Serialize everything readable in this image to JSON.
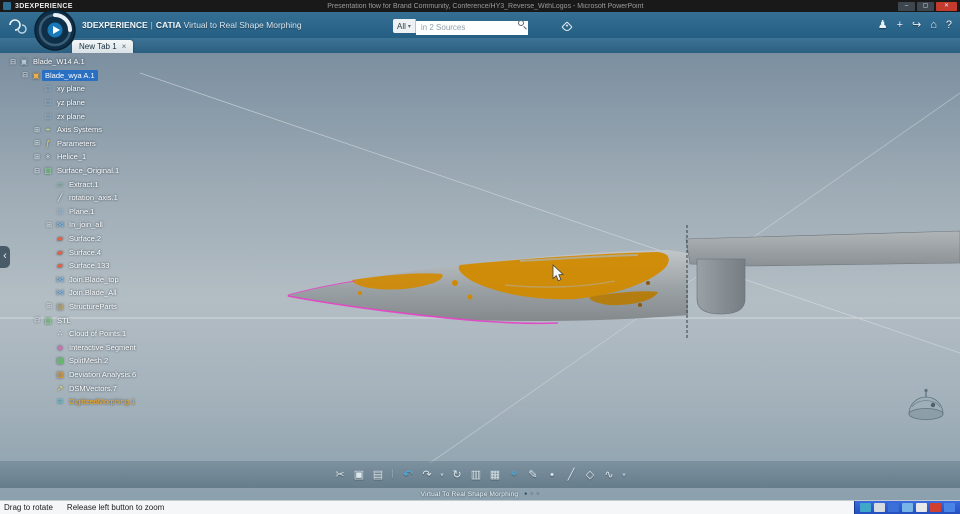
{
  "colors": {
    "selection_blue": "#2a70c2",
    "deviation_orange": "#d18a00",
    "deviation_orange_dark": "#b87a00",
    "scan_magenta": "#e83fc8",
    "blade_light": "#c2c6c8",
    "blade_mid": "#9aa1a4",
    "blade_dark": "#84898c",
    "hub_light": "#b0b5b8",
    "hub_dark": "#8a9094",
    "close_red": "#c23b2e",
    "line_gray": "#dbe1e5"
  },
  "window": {
    "brand": "3DEXPERIENCE",
    "title": "Presentation flow for Brand Community, Conference/HY3_Reverse_WithLogos - Microsoft PowerPoint",
    "minimize": "–",
    "maximize": "▢",
    "close": "✕"
  },
  "appbar": {
    "brand": "3DEXPERIENCE",
    "pipe": "|",
    "app": "CATIA",
    "title": "Virtual to Real Shape Morphing",
    "search": {
      "filter": "All",
      "caret": "▾",
      "placeholder": "in 2 Sources"
    },
    "right_icons": [
      {
        "name": "user-icon",
        "glyph": "♟"
      },
      {
        "name": "add-icon",
        "glyph": "+"
      },
      {
        "name": "share-icon",
        "glyph": "↪"
      },
      {
        "name": "home-icon",
        "glyph": "⌂"
      },
      {
        "name": "help-icon",
        "glyph": "?"
      }
    ]
  },
  "tabbar": {
    "tabs": [
      {
        "label": "New Tab 1",
        "close": "×"
      }
    ]
  },
  "tree": {
    "items": [
      {
        "label": "Blade_W14 A.1",
        "level": 0,
        "icon": "product-icon",
        "glyph": "▣",
        "color": "#b0c8d8",
        "exp": "⊟"
      },
      {
        "label": "Blade_wya A.1",
        "level": 1,
        "icon": "part-icon",
        "glyph": "▣",
        "color": "#f0b050",
        "exp": "⊟",
        "selected": true
      },
      {
        "label": "xy plane",
        "level": 2,
        "icon": "plane-icon",
        "glyph": "□",
        "color": "#8fd0ff",
        "exp": ""
      },
      {
        "label": "yz plane",
        "level": 2,
        "icon": "plane-icon",
        "glyph": "□",
        "color": "#8fd0ff",
        "exp": ""
      },
      {
        "label": "zx plane",
        "level": 2,
        "icon": "plane-icon",
        "glyph": "□",
        "color": "#8fd0ff",
        "exp": ""
      },
      {
        "label": "Axis Systems",
        "level": 2,
        "icon": "axis-system-icon",
        "glyph": "⌖",
        "color": "#d8e890",
        "exp": "⊞"
      },
      {
        "label": "Parameters",
        "level": 2,
        "icon": "parameters-icon",
        "glyph": "ƒ",
        "color": "#f0d060",
        "exp": "⊞"
      },
      {
        "label": "Helice_1",
        "level": 2,
        "icon": "feature-icon",
        "glyph": "∗",
        "color": "#c8d4de",
        "exp": "⊞"
      },
      {
        "label": "Surface_Original.1",
        "level": 2,
        "icon": "geometrical-set-icon",
        "glyph": "▧",
        "color": "#90e090",
        "exp": "⊟"
      },
      {
        "label": "Extract.1",
        "level": 3,
        "icon": "extract-icon",
        "glyph": "▱",
        "color": "#80d0a0",
        "exp": ""
      },
      {
        "label": "rotation_axis.1",
        "level": 3,
        "icon": "axis-line-icon",
        "glyph": "╱",
        "color": "#e8eef2",
        "exp": ""
      },
      {
        "label": "Plane.1",
        "level": 3,
        "icon": "plane-icon",
        "glyph": "□",
        "color": "#8fd0ff",
        "exp": ""
      },
      {
        "label": "In_join_all",
        "level": 3,
        "icon": "join-icon",
        "glyph": "⋈",
        "color": "#80b8e8",
        "exp": "⊞"
      },
      {
        "label": "Surface.2",
        "level": 3,
        "icon": "surface-icon",
        "glyph": "▰",
        "color": "#e86040",
        "exp": ""
      },
      {
        "label": "Surface.4",
        "level": 3,
        "icon": "surface-icon",
        "glyph": "▰",
        "color": "#e86040",
        "exp": ""
      },
      {
        "label": "Surface.133",
        "level": 3,
        "icon": "surface-icon",
        "glyph": "▰",
        "color": "#e86040",
        "exp": ""
      },
      {
        "label": "Join.Blade_top",
        "level": 3,
        "icon": "join-icon",
        "glyph": "⋈",
        "color": "#80b8e8",
        "exp": ""
      },
      {
        "label": "Join.Blade_All",
        "level": 3,
        "icon": "join-icon",
        "glyph": "⋈",
        "color": "#80b8e8",
        "exp": ""
      },
      {
        "label": "StructureParts",
        "level": 3,
        "icon": "folder-icon",
        "glyph": "▤",
        "color": "#c8b070",
        "exp": "⊞"
      },
      {
        "label": "STL",
        "level": 2,
        "icon": "geometrical-set-icon",
        "glyph": "▧",
        "color": "#90e090",
        "exp": "⊟"
      },
      {
        "label": "Cloud of Points.1",
        "level": 3,
        "icon": "point-cloud-icon",
        "glyph": "∴",
        "color": "#e8eef2",
        "exp": ""
      },
      {
        "label": "Interactive Segment",
        "level": 3,
        "icon": "segment-icon",
        "glyph": "◈",
        "color": "#e870c0",
        "exp": ""
      },
      {
        "label": "SplitMesh.2",
        "level": 3,
        "icon": "mesh-icon",
        "glyph": "▦",
        "color": "#70d070",
        "exp": ""
      },
      {
        "label": "Deviation Analysis.6",
        "level": 3,
        "icon": "analysis-icon",
        "glyph": "▨",
        "color": "#f0a030",
        "exp": ""
      },
      {
        "label": "DSMVectors.7",
        "level": 3,
        "icon": "vectors-icon",
        "glyph": "↗",
        "color": "#f0e060",
        "exp": ""
      },
      {
        "label": "DigitizedMorphing.1",
        "level": 3,
        "icon": "morphing-icon",
        "glyph": "≋",
        "color": "#60d0e0",
        "exp": "",
        "highlight": true
      }
    ]
  },
  "viewport": {
    "collapse_glyph": "‹"
  },
  "toolbar": {
    "items": [
      {
        "name": "cut-icon",
        "glyph": "✂"
      },
      {
        "name": "copy-icon",
        "glyph": "▣"
      },
      {
        "name": "paste-icon",
        "glyph": "▤"
      },
      {
        "name": "toolbar-separator",
        "glyph": "│",
        "dim": true
      },
      {
        "name": "undo-icon",
        "glyph": "↶",
        "accent": true
      },
      {
        "name": "redo-icon",
        "glyph": "↷"
      },
      {
        "name": "history-caret-icon",
        "glyph": "▾",
        "dim": true
      },
      {
        "name": "update-icon",
        "glyph": "↻"
      },
      {
        "name": "analysis-display-icon",
        "glyph": "▥"
      },
      {
        "name": "checker-icon",
        "glyph": "▦"
      },
      {
        "name": "measure-icon",
        "glyph": "⌖",
        "accent": true
      },
      {
        "name": "sketch-icon",
        "glyph": "✎"
      },
      {
        "name": "point-icon",
        "glyph": "•"
      },
      {
        "name": "line-icon",
        "glyph": "╱"
      },
      {
        "name": "surface-icon",
        "glyph": "◇"
      },
      {
        "name": "curve-icon",
        "glyph": "∿"
      },
      {
        "name": "more-caret-icon",
        "glyph": "▾",
        "dim": true
      }
    ]
  },
  "indicator": {
    "label": "Virtual To Real Shape Morphing",
    "dots": [
      "●",
      "○",
      "○"
    ]
  },
  "status": {
    "hint_rotate": "Drag to rotate",
    "hint_zoom": "Release left button to zoom"
  },
  "taskbar": {
    "icons": [
      {
        "name": "tray-app-1",
        "color": "#3fa8c8"
      },
      {
        "name": "tray-app-2",
        "color": "#d8dce0"
      },
      {
        "name": "tray-app-3",
        "color": "#3a70d8"
      },
      {
        "name": "tray-app-4",
        "color": "#78b4e8"
      },
      {
        "name": "tray-app-5",
        "color": "#e8e8e8"
      },
      {
        "name": "tray-app-6",
        "color": "#d04030"
      },
      {
        "name": "tray-app-7",
        "color": "#4a84e4"
      }
    ]
  }
}
